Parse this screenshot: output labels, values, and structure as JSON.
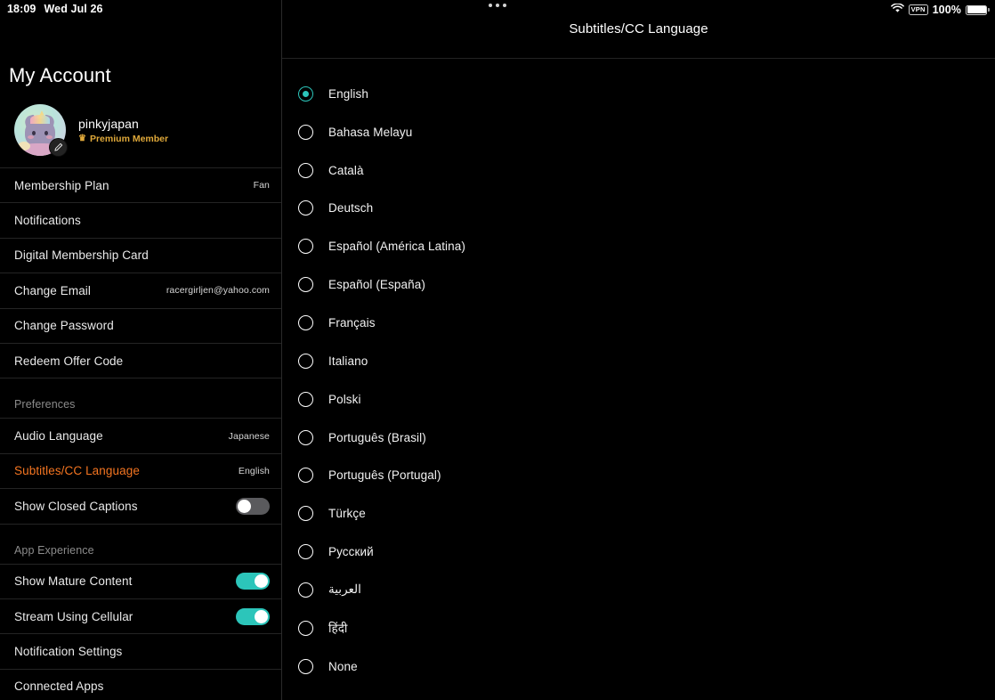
{
  "status_bar": {
    "time": "18:09",
    "date": "Wed Jul 26",
    "battery_percent": "100%",
    "vpn_label": "VPN",
    "wifi_icon": "wifi-icon",
    "battery_icon": "battery-icon",
    "multitask_handle_icon": "multitask-handle-icon"
  },
  "sidebar": {
    "title": "My Account",
    "profile": {
      "username": "pinkyjapan",
      "tier": "Premium Member",
      "crown_icon": "crown-icon",
      "edit_icon": "pencil-edit-icon",
      "avatar_icon": "avatar"
    },
    "account_items": [
      {
        "label": "Membership Plan",
        "value": "Fan"
      },
      {
        "label": "Notifications",
        "value": ""
      },
      {
        "label": "Digital Membership Card",
        "value": ""
      },
      {
        "label": "Change Email",
        "value": "racergirljen@yahoo.com"
      },
      {
        "label": "Change Password",
        "value": ""
      },
      {
        "label": "Redeem Offer Code",
        "value": ""
      }
    ],
    "preferences": {
      "heading": "Preferences",
      "items": [
        {
          "label": "Audio Language",
          "value": "Japanese",
          "type": "value",
          "active": false
        },
        {
          "label": "Subtitles/CC Language",
          "value": "English",
          "type": "value",
          "active": true
        },
        {
          "label": "Show Closed Captions",
          "value": "",
          "type": "toggle",
          "on": false,
          "active": false
        }
      ]
    },
    "app_experience": {
      "heading": "App Experience",
      "items": [
        {
          "label": "Show Mature Content",
          "value": "",
          "type": "toggle",
          "on": true
        },
        {
          "label": "Stream Using Cellular",
          "value": "",
          "type": "toggle",
          "on": true
        },
        {
          "label": "Notification Settings",
          "value": "",
          "type": "value"
        },
        {
          "label": "Connected Apps",
          "value": "",
          "type": "value"
        }
      ]
    },
    "accent_color": "#f47521",
    "toggle_on_color": "#2cc5ba"
  },
  "main": {
    "title": "Subtitles/CC Language",
    "selected": "English",
    "options": [
      "English",
      "Bahasa Melayu",
      "Català",
      "Deutsch",
      "Español (América Latina)",
      "Español (España)",
      "Français",
      "Italiano",
      "Polski",
      "Português (Brasil)",
      "Português (Portugal)",
      "Türkçe",
      "Русский",
      "العربية",
      "हिंदी",
      "None"
    ]
  }
}
